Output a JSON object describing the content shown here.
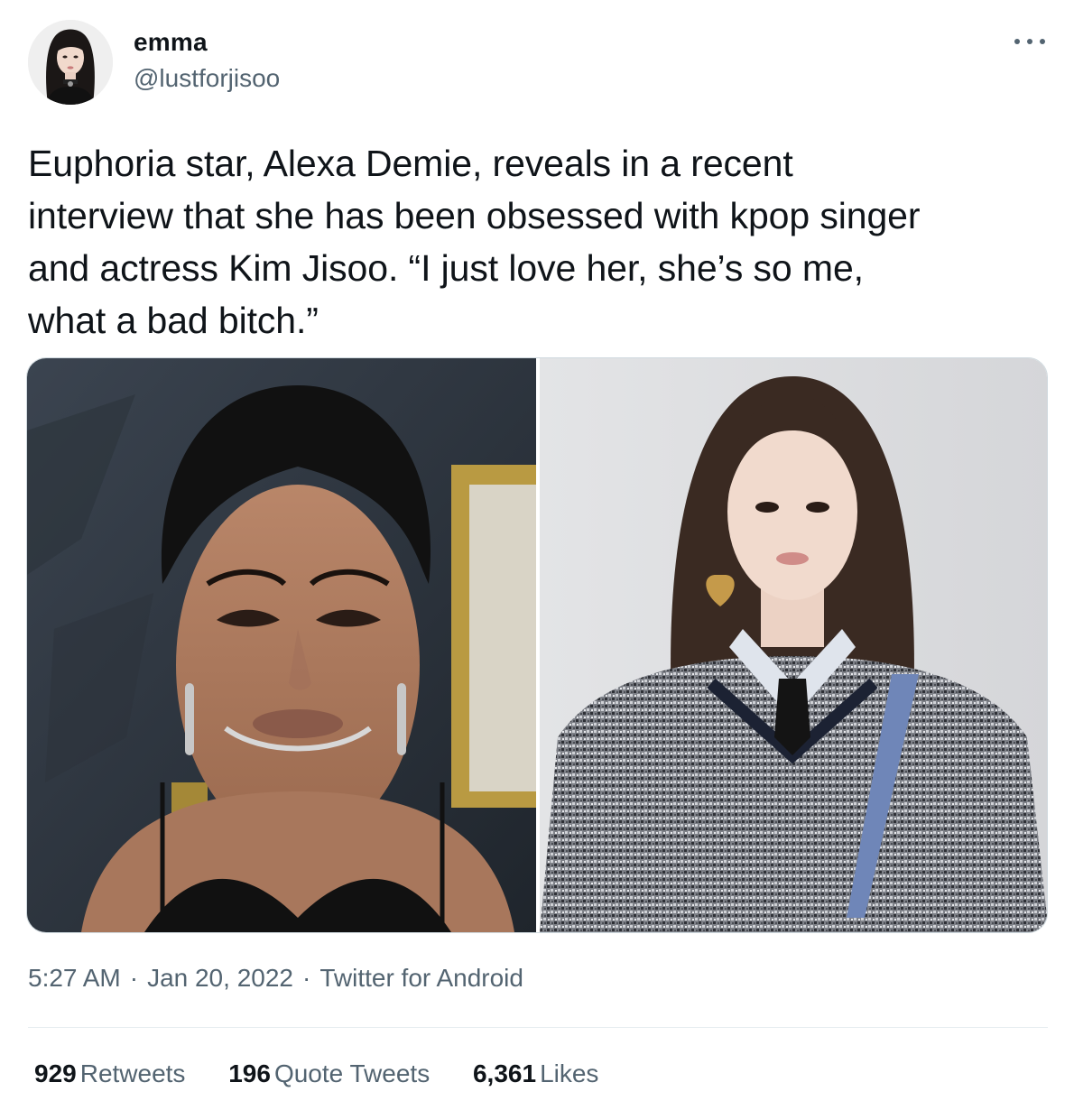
{
  "tweet": {
    "author": {
      "name": "emma",
      "handle": "@lustforjisoo"
    },
    "text_lines": [
      "Euphoria star, Alexa Demie, reveals in a recent",
      "interview that she has been obsessed with kpop singer",
      "and actress Kim Jisoo. “I just love her, she’s so me,",
      "what a bad bitch.”"
    ],
    "more_icon": "more-horizontal-icon",
    "meta": {
      "time": "5:27 AM",
      "date": "Jan 20, 2022",
      "source": "Twitter for Android",
      "separator": "·"
    },
    "stats": {
      "retweets": {
        "count": "929",
        "label": "Retweets"
      },
      "quote_tweets": {
        "count": "196",
        "label": "Quote Tweets"
      },
      "likes": {
        "count": "6,361",
        "label": "Likes"
      }
    }
  },
  "colors": {
    "text_primary": "#0f1419",
    "text_secondary": "#536471",
    "border": "#cfd9de",
    "divider": "#e6ecf0"
  }
}
